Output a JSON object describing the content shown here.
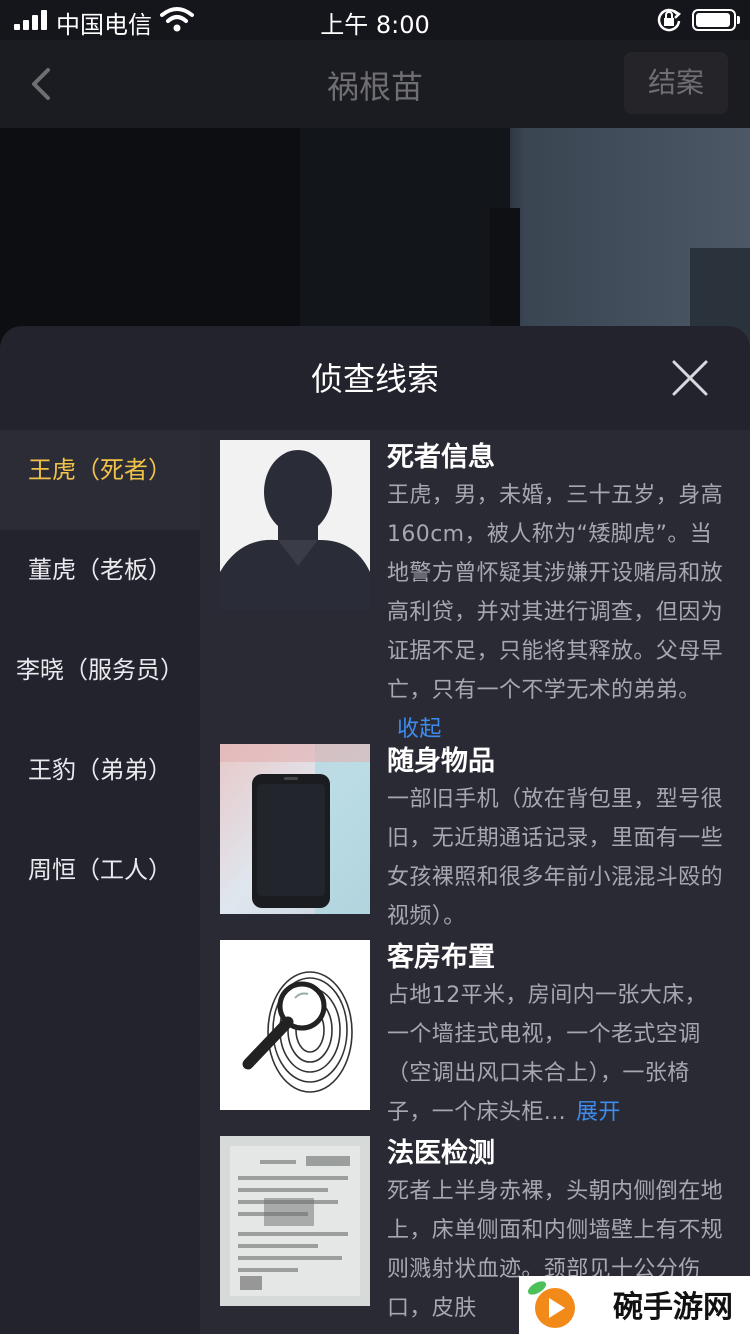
{
  "status_bar": {
    "carrier": "中国电信",
    "time": "上午 8:00"
  },
  "nav": {
    "title": "祸根苗",
    "close_case_label": "结案"
  },
  "sheet": {
    "title": "侦查线索"
  },
  "sidebar": {
    "items": [
      {
        "label": "王虎（死者）",
        "active": true
      },
      {
        "label": "董虎（老板）",
        "active": false
      },
      {
        "label": "李晓（服务员）",
        "active": false
      },
      {
        "label": "王豹（弟弟）",
        "active": false
      },
      {
        "label": "周恒（工人）",
        "active": false
      }
    ]
  },
  "clues": [
    {
      "title": "死者信息",
      "text": "王虎，男，未婚，三十五岁，身高160cm，被人称为“矮脚虎”。当地警方曾怀疑其涉嫌开设赌局和放高利贷，并对其进行调查，但因为证据不足，只能将其释放。父母早亡，只有一个不学无术的弟弟。",
      "link": "收起",
      "thumb_icon": "silhouette-icon"
    },
    {
      "title": "随身物品",
      "text": "一部旧手机（放在背包里，型号很旧，无近期通话记录，里面有一些女孩裸照和很多年前小混混斗殴的视频）。",
      "link": "",
      "thumb_icon": "phone-icon"
    },
    {
      "title": "客房布置",
      "text": "占地12平米，房间内一张大床，一个墙挂式电视，一个老式空调（空调出风口未合上），一张椅子，一个床头柜...",
      "link": "展开",
      "thumb_icon": "fingerprint-magnifier-icon"
    },
    {
      "title": "法医检测",
      "text": "死者上半身赤裸，头朝内侧倒在地上，床单侧面和内侧墙壁上有不规则溅射状血迹。颈部见十公分伤口，皮肤",
      "link": "",
      "thumb_icon": "report-document-icon"
    }
  ],
  "watermark": {
    "text": "碗手游网"
  },
  "colors": {
    "active_tab": "#f0c24a",
    "link": "#3d8cf0",
    "sheet_bg": "#23232d",
    "content_bg": "#2a2a34"
  }
}
